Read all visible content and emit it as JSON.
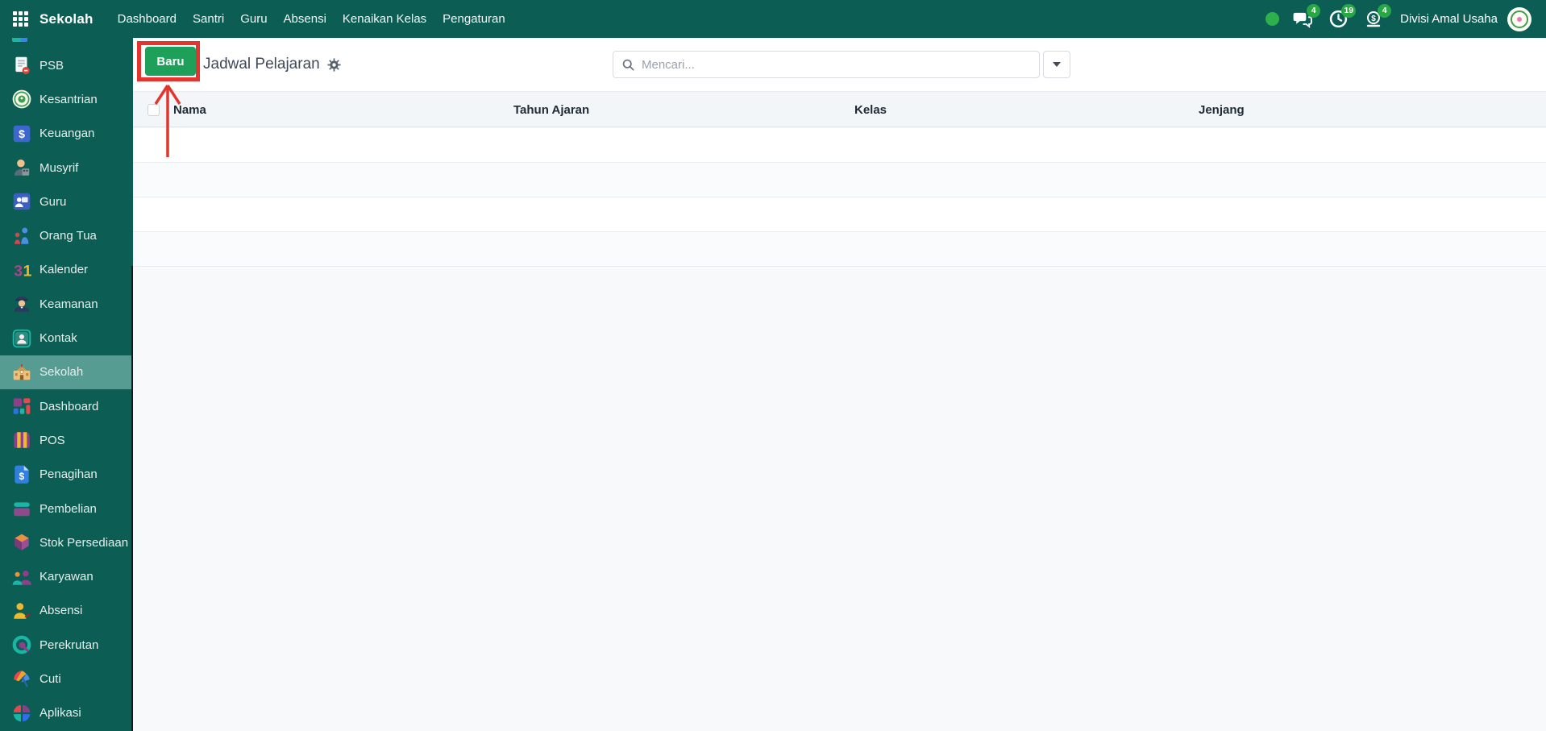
{
  "colors": {
    "navbar_teal": "#0c5e54",
    "sidebar_active": "#579c92",
    "primary_button_green": "#1fa05a",
    "badge_green": "#28a745",
    "annotation_red": "#e3352d"
  },
  "navbar": {
    "app_title": "Sekolah",
    "menu": [
      "Dashboard",
      "Santri",
      "Guru",
      "Absensi",
      "Kenaikan Kelas",
      "Pengaturan"
    ],
    "status": {
      "messages_badge": "4",
      "activities_badge": "19",
      "payroll_badge": "4"
    },
    "user_name": "Divisi Amal Usaha"
  },
  "sidebar": {
    "items": [
      {
        "label": "PSB",
        "icon": "document-icon",
        "active": false
      },
      {
        "label": "Kesantrian",
        "icon": "kesantrian-logo-icon",
        "active": false
      },
      {
        "label": "Keuangan",
        "icon": "dollar-square-icon",
        "active": false
      },
      {
        "label": "Musyrif",
        "icon": "musyrif-person-icon",
        "active": false
      },
      {
        "label": "Guru",
        "icon": "guru-board-icon",
        "active": false
      },
      {
        "label": "Orang Tua",
        "icon": "parents-icon",
        "active": false
      },
      {
        "label": "Kalender",
        "icon": "calendar-31-icon",
        "active": false
      },
      {
        "label": "Keamanan",
        "icon": "police-officer-icon",
        "active": false
      },
      {
        "label": "Kontak",
        "icon": "contact-card-icon",
        "active": false
      },
      {
        "label": "Sekolah",
        "icon": "school-building-icon",
        "active": true
      },
      {
        "label": "Dashboard",
        "icon": "dashboard-tiles-icon",
        "active": false
      },
      {
        "label": "POS",
        "icon": "pos-awning-icon",
        "active": false
      },
      {
        "label": "Penagihan",
        "icon": "billing-doc-icon",
        "active": false
      },
      {
        "label": "Pembelian",
        "icon": "purchase-icon",
        "active": false
      },
      {
        "label": "Stok Persediaan",
        "icon": "inventory-box-icon",
        "active": false
      },
      {
        "label": "Karyawan",
        "icon": "employees-icon",
        "active": false
      },
      {
        "label": "Absensi",
        "icon": "attendance-icon",
        "active": false
      },
      {
        "label": "Perekrutan",
        "icon": "recruitment-icon",
        "active": false
      },
      {
        "label": "Cuti",
        "icon": "leave-umbrella-icon",
        "active": false
      },
      {
        "label": "Aplikasi",
        "icon": "apps-pie-icon",
        "active": false
      }
    ]
  },
  "content": {
    "new_button_label": "Baru",
    "page_title": "Jadwal Pelajaran",
    "search_placeholder": "Mencari...",
    "table": {
      "columns": [
        "Nama",
        "Tahun Ajaran",
        "Kelas",
        "Jenjang"
      ],
      "rows": [],
      "empty_row_count": 4
    }
  }
}
